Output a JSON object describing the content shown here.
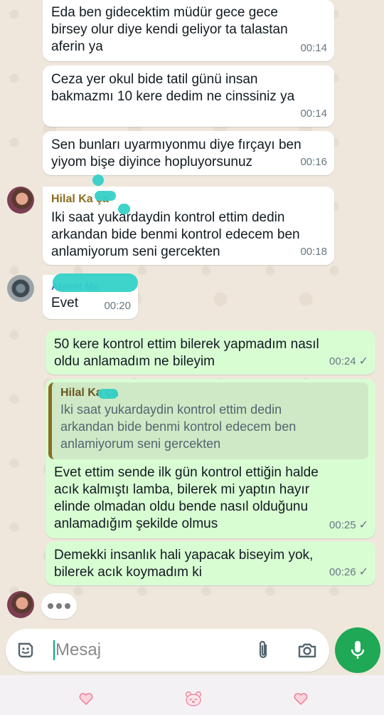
{
  "colors": {
    "chat_bg": "#efe7dc",
    "incoming_bubble": "#ffffff",
    "outgoing_bubble": "#d9fdd3",
    "hilal_name": "#8a6d1f",
    "ahmet_name": "#5b56c6",
    "mic_button": "#1fa855"
  },
  "messages": [
    {
      "text": "Eda ben gidecektim müdür gece gece\nbirsey olur diye kendi geliyor ta talastan\naferin ya",
      "time": "00:14"
    },
    {
      "text": "Ceza yer okul bide tatil günü insan\nbakmazmı 10 kere dedim ne cinssiniz ya",
      "time": "00:14"
    },
    {
      "text": "Sen bunları uyarmıyonmu diye fırçayı ben\nyiyom bişe diyince hopluyorsunuz",
      "time": "00:16"
    },
    {
      "sender": "Hilal Ka  ça",
      "text": "Iki saat yukardaydin kontrol ettim dedin\narkandan bide benmi kontrol edecem ben\nanlamiyorum seni gercekten",
      "time": "00:18"
    },
    {
      "sender": "Ahmet Me",
      "text": "Evet",
      "time": "00:20"
    },
    {
      "text": "50 kere kontrol ettim bilerek yapmadım nasıl\noldu anlamadım ne bileyim",
      "time": "00:24"
    },
    {
      "quote_sender": "Hilal Ka  ça",
      "quote_text": "Iki saat yukardaydin kontrol ettim dedin\narkandan bide benmi kontrol edecem ben\nanlamiyorum seni gercekten",
      "text": "Evet ettim sende ilk gün kontrol ettiğin halde\nacık kalmıştı lamba, bilerek mi yaptın hayır\nelinde olmadan oldu bende nasıl olduğunu\nanlamadığım şekilde olmus",
      "time": "00:25"
    },
    {
      "text": "Demekki insanlık hali yapacak biseyim yok,\nbilerek acık koymadım ki",
      "time": "00:26"
    }
  ],
  "tick_symbol": "✓",
  "typing_indicator": "•••",
  "input": {
    "placeholder": "Mesaj"
  },
  "icons": [
    "sticker-icon",
    "attach-icon",
    "camera-icon",
    "mic-icon",
    "heart-icon",
    "bear-icon"
  ]
}
